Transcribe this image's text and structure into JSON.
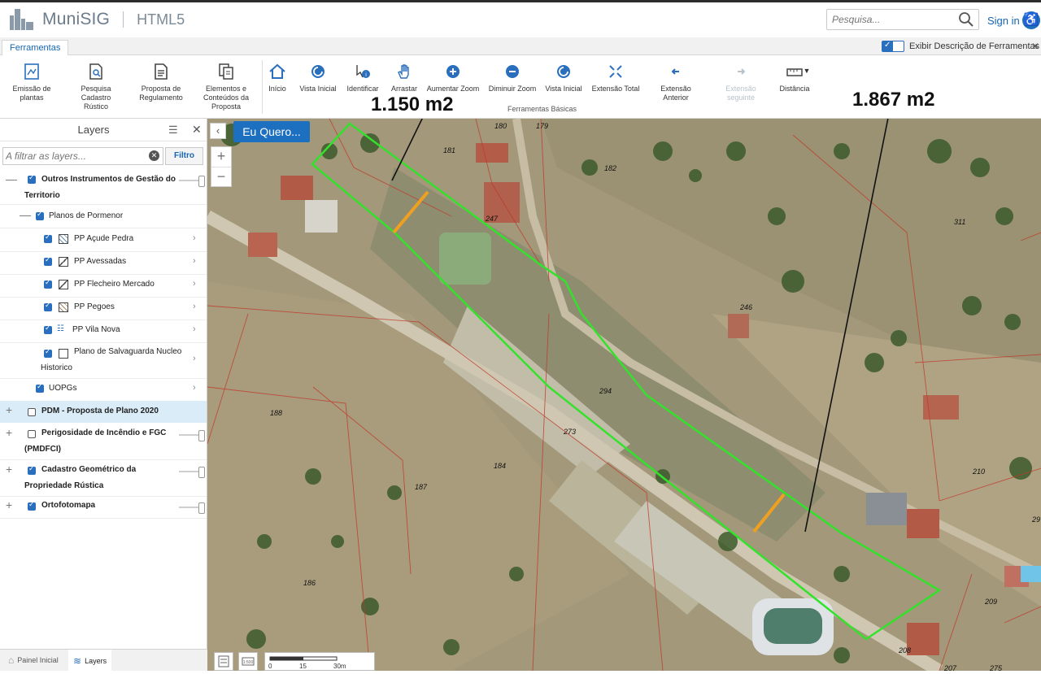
{
  "app": {
    "name": "MuniSIG",
    "sub": "HTML5"
  },
  "header": {
    "search_placeholder": "Pesquisa...",
    "signin": "Sign in"
  },
  "ribbon": {
    "tab": "Ferramentas",
    "show_desc_label": "Exibir Descrição de Ferramentas",
    "group_label": "Ferramentas Básicas",
    "tools": [
      {
        "label": "Emissão de plantas",
        "icon": "print-map-icon"
      },
      {
        "label": "Pesquisa Cadastro Rústico",
        "icon": "search-document-icon"
      },
      {
        "label": "Proposta de Regulamento",
        "icon": "document-icon"
      },
      {
        "label": "Elementos e Conteúdos da Proposta",
        "icon": "documents-icon"
      },
      {
        "label": "Início",
        "icon": "home-icon"
      },
      {
        "label": "Vista Inicial",
        "icon": "refresh-icon"
      },
      {
        "label": "Identificar",
        "icon": "identify-icon"
      },
      {
        "label": "Arrastar",
        "icon": "hand-icon"
      },
      {
        "label": "Aumentar Zoom",
        "icon": "zoom-in-icon"
      },
      {
        "label": "Diminuir Zoom",
        "icon": "zoom-out-icon"
      },
      {
        "label": "Vista Inicial",
        "icon": "refresh-icon"
      },
      {
        "label": "Extensão Total",
        "icon": "full-extent-icon"
      },
      {
        "label": "Extensão Anterior",
        "icon": "back-arrow-icon"
      },
      {
        "label": "Extensão seguinte",
        "icon": "forward-arrow-icon"
      },
      {
        "label": "Distância",
        "icon": "ruler-icon"
      }
    ]
  },
  "layers": {
    "title": "Layers",
    "filter_placeholder": "A filtrar as layers...",
    "filter_button": "Filtro",
    "items": [
      {
        "label": "Outros Instrumentos de Gestão do",
        "label2": "Territorio",
        "checked": true
      },
      {
        "label": "Planos de Pormenor",
        "checked": true
      },
      {
        "label": "PP Açude Pedra",
        "checked": true
      },
      {
        "label": "PP Avessadas",
        "checked": true
      },
      {
        "label": "PP Flecheiro Mercado",
        "checked": true
      },
      {
        "label": "PP Pegoes",
        "checked": true
      },
      {
        "label": "PP Vila Nova",
        "checked": true
      },
      {
        "label": "Plano de Salvaguarda Nucleo",
        "label2": "Historico",
        "checked": true
      },
      {
        "label": "UOPGs",
        "checked": true
      },
      {
        "label": "PDM - Proposta de Plano 2020",
        "checked": false
      },
      {
        "label": "Perigosidade de Incêndio e FGC",
        "label2": "(PMDFCI)",
        "checked": false
      },
      {
        "label": "Cadastro Geométrico da",
        "label2": "Propriedade Rústica",
        "checked": true
      },
      {
        "label": "Ortofotomapa",
        "checked": true
      }
    ],
    "bottom_tabs": [
      "Painel Inicial",
      "Layers"
    ]
  },
  "map": {
    "eu_quero": "Eu Quero...",
    "area_left": "1.150 m2",
    "area_right": "1.867 m2",
    "parcel_numbers": [
      "180",
      "181",
      "179",
      "182",
      "247",
      "311",
      "246",
      "294",
      "273",
      "188",
      "184",
      "187",
      "186",
      "210",
      "209",
      "208",
      "275",
      "207",
      "29"
    ],
    "scale_labels": [
      "0",
      "15",
      "30m"
    ]
  }
}
